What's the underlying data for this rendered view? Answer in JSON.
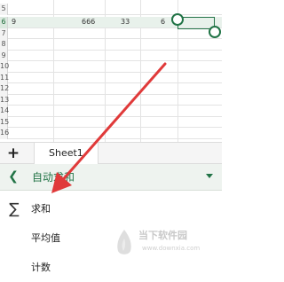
{
  "spreadsheet": {
    "row_numbers": [
      "5",
      "6",
      "7",
      "8",
      "9",
      "10",
      "11",
      "12",
      "13",
      "14",
      "15",
      "16"
    ],
    "selected_row_values": [
      "9",
      "666",
      "33",
      "6"
    ]
  },
  "sheets": {
    "add_label": "+",
    "tabs": [
      "Sheet1"
    ]
  },
  "panel": {
    "back_icon": "chevron-left-icon",
    "title": "自动求和",
    "items": [
      {
        "icon": "sigma-icon",
        "label": "求和"
      },
      {
        "icon": "",
        "label": "平均值"
      },
      {
        "icon": "",
        "label": "计数"
      }
    ]
  },
  "watermark": {
    "line1": "当下软件园",
    "line2": "www.downxia.com"
  },
  "colors": {
    "accent": "#217346",
    "arrow": "#e03a3a"
  }
}
